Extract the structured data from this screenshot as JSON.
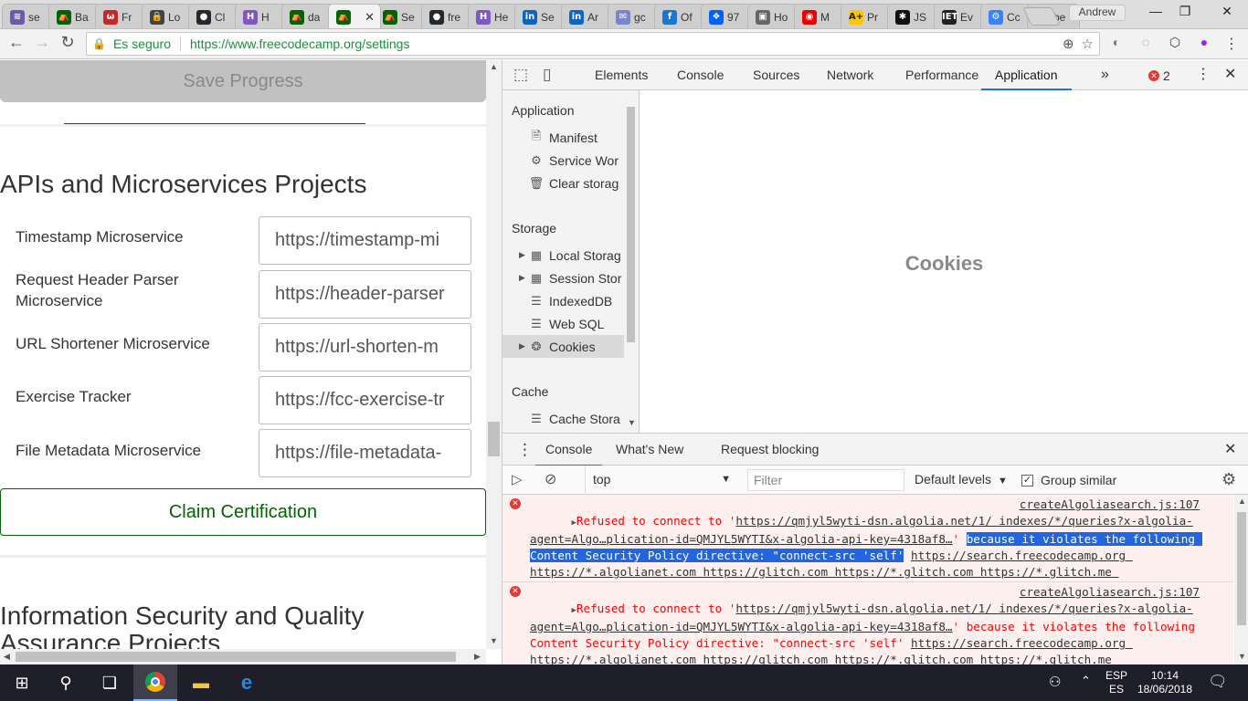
{
  "browser": {
    "tabs": [
      {
        "title": "se",
        "favicon_color": "#6b5ba8",
        "favicon_glyph": "≋"
      },
      {
        "title": "Ba",
        "favicon_color": "#006400",
        "favicon_glyph": "⛺"
      },
      {
        "title": "Fr",
        "favicon_color": "#c62828",
        "favicon_glyph": "ω"
      },
      {
        "title": "Lo",
        "favicon_color": "#444",
        "favicon_glyph": "🔒"
      },
      {
        "title": "Cl",
        "favicon_color": "#24292e",
        "favicon_glyph": "●"
      },
      {
        "title": "H",
        "favicon_color": "#7e57c2",
        "favicon_glyph": "H"
      },
      {
        "title": "da",
        "favicon_color": "#006400",
        "favicon_glyph": "⛺"
      },
      {
        "title": "",
        "favicon_color": "#006400",
        "favicon_glyph": "⛺",
        "active": true
      },
      {
        "title": "Se",
        "favicon_color": "#006400",
        "favicon_glyph": "⛺"
      },
      {
        "title": "fre",
        "favicon_color": "#24292e",
        "favicon_glyph": "●"
      },
      {
        "title": "He",
        "favicon_color": "#7e57c2",
        "favicon_glyph": "H"
      },
      {
        "title": "Se",
        "favicon_color": "#0a66c2",
        "favicon_glyph": "in"
      },
      {
        "title": "Ar",
        "favicon_color": "#0a66c2",
        "favicon_glyph": "in"
      },
      {
        "title": "gc",
        "favicon_color": "#7986cb",
        "favicon_glyph": "✉"
      },
      {
        "title": "Of",
        "favicon_color": "#1976d2",
        "favicon_glyph": "f"
      },
      {
        "title": "97",
        "favicon_color": "#0061fe",
        "favicon_glyph": "❖"
      },
      {
        "title": "Ho",
        "favicon_color": "#666",
        "favicon_glyph": "▣"
      },
      {
        "title": "M",
        "favicon_color": "#e60000",
        "favicon_glyph": "◉"
      },
      {
        "title": "Pr",
        "favicon_color": "#f9c800",
        "favicon_glyph": "A+"
      },
      {
        "title": "JS",
        "favicon_color": "#111",
        "favicon_glyph": "✱"
      },
      {
        "title": "Ev",
        "favicon_color": "#222",
        "favicon_glyph": "IET"
      },
      {
        "title": "Cc",
        "favicon_color": "#3b82f6",
        "favicon_glyph": "⚙"
      },
      {
        "title": "be",
        "favicon_color": "#ffffff",
        "favicon_glyph": "G"
      }
    ],
    "profile_name": "Andrew",
    "secure_label": "Es seguro",
    "url": "https://www.freecodecamp.org/settings"
  },
  "page": {
    "save_progress": "Save Progress",
    "section1_title": "APIs and Microservices Projects",
    "projects": [
      {
        "label": "Timestamp Microservice",
        "value": "https://timestamp-mi"
      },
      {
        "label": "Request Header Parser Microservice",
        "value": "https://header-parser"
      },
      {
        "label": "URL Shortener Microservice",
        "value": "https://url-shorten-m"
      },
      {
        "label": "Exercise Tracker",
        "value": "https://fcc-exercise-tr"
      },
      {
        "label": "File Metadata Microservice",
        "value": "https://file-metadata-"
      }
    ],
    "claim_certification": "Claim Certification",
    "section2_title": "Information Security and Quality Assurance Projects"
  },
  "devtools": {
    "tabs": [
      "Elements",
      "Console",
      "Sources",
      "Network",
      "Performance",
      "Application"
    ],
    "more_tabs": "»",
    "error_count": "2",
    "sidebar": {
      "application_head": "Application",
      "application_items": [
        "Manifest",
        "Service Wor",
        "Clear storag"
      ],
      "storage_head": "Storage",
      "storage_items": [
        "Local Storag",
        "Session Stor",
        "IndexedDB",
        "Web SQL",
        "Cookies"
      ],
      "cache_head": "Cache",
      "cache_items": [
        "Cache Stora"
      ]
    },
    "main_heading": "Cookies",
    "drawer_tabs": [
      "Console",
      "What's New",
      "Request blocking"
    ],
    "console_toolbar": {
      "context": "top",
      "filter_placeholder": "Filter",
      "levels": "Default levels",
      "group_similar": "Group similar"
    },
    "messages": [
      {
        "prefix": "Refused to connect to '",
        "url_part": "https://qmjyl5wyti-dsn.algolia.net/1/ indexes/*/queries?x-algolia-agent=Algo…plication-id=QMJYL5WYTI&x-algolia-api-key=4318af8…",
        "mid": "' ",
        "reason": "because it violates the following Content Security Policy directive: \"connect-src 'self'",
        "after_reason": " ",
        "csp_urls": "https://search.freecodecamp.org https://*.algolianet.com https://glitch.com https://*.glitch.com https://*.glitch.me https://*.cloudflare.com",
        "suffix": "\".",
        "source": "createAlgoliasearch.js:107"
      },
      {
        "prefix": "Refused to connect to '",
        "url_part": "https://qmjyl5wyti-dsn.algolia.net/1/ indexes/*/queries?x-algolia-agent=Algo…plication-id=QMJYL5WYTI&x-algolia-api-key=4318af8…",
        "mid": "' ",
        "reason": "because it violates the following Content Security Policy directive: \"connect-src 'self'",
        "after_reason": " ",
        "csp_urls": "https://search.freecodecamp.org https://*.algolianet.com https://glitch.com https://*.glitch.com https://*.glitch.me https://*.cloudflare.com",
        "suffix": "\".",
        "source": "createAlgoliasearch.js:107"
      }
    ]
  },
  "taskbar": {
    "lang_top": "ESP",
    "lang_bottom": "ES",
    "time": "10:14",
    "date": "18/06/2018"
  }
}
